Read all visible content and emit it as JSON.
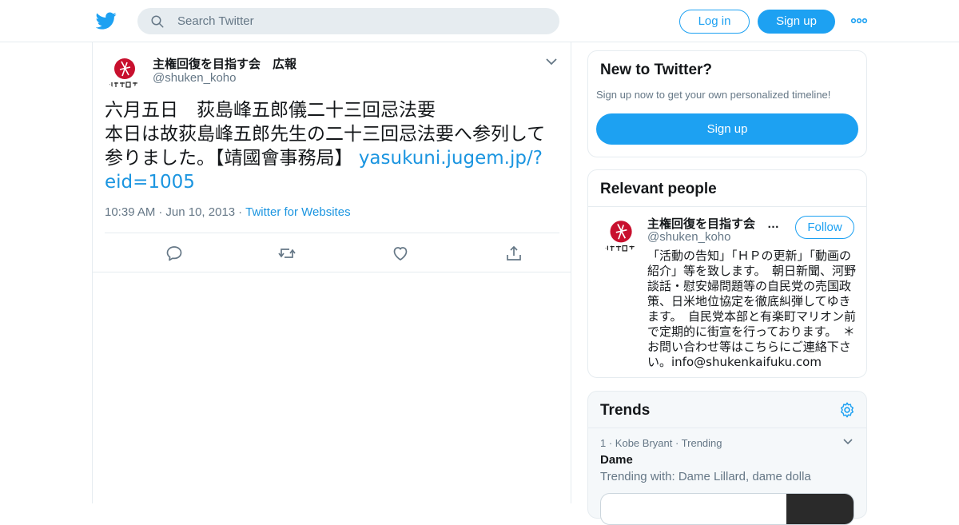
{
  "header": {
    "search_placeholder": "Search Twitter",
    "login_label": "Log in",
    "signup_label": "Sign up"
  },
  "tweet": {
    "author_name": "主権回復を目指す会　広報",
    "author_handle": "@shuken_koho",
    "text_line1": "六月五日　荻島峰五郎儀二十三回忌法要",
    "text_line2": "本日は故荻島峰五郎先生の二十三回忌法要へ参列して参りました。【靖國會事務局】",
    "link": "yasukuni.jugem.jp/?eid=1005",
    "time": "10:39 AM",
    "date": "Jun 10, 2013",
    "source": "Twitter for Websites"
  },
  "new_to_twitter": {
    "title": "New to Twitter?",
    "subtitle": "Sign up now to get your own personalized timeline!",
    "signup_label": "Sign up"
  },
  "relevant_people": {
    "title": "Relevant people",
    "name": "主権回復を目指す会　…",
    "handle": "@shuken_koho",
    "follow_label": "Follow",
    "bio": "「活動の告知」「ＨＰの更新」「動画の紹介」等を致します。　朝日新聞、河野談話・慰安婦問題等の自民党の売国政策、日米地位協定を徹底糾弾してゆきます。　自民党本部と有楽町マリオン前で定期的に街宣を行っております。　＊お問い合わせ等はこちらにご連絡下さい。info@shukenkaifuku.com"
  },
  "trends": {
    "title": "Trends",
    "items": [
      {
        "rank": "1",
        "context": "Kobe Bryant",
        "status": "Trending",
        "name": "Dame",
        "trending_with": "Trending with: Dame Lillard, dame dolla"
      }
    ]
  },
  "colors": {
    "brand": "#1da1f2",
    "link": "#1b95e0",
    "muted": "#657786",
    "border": "#e6ecf0"
  }
}
